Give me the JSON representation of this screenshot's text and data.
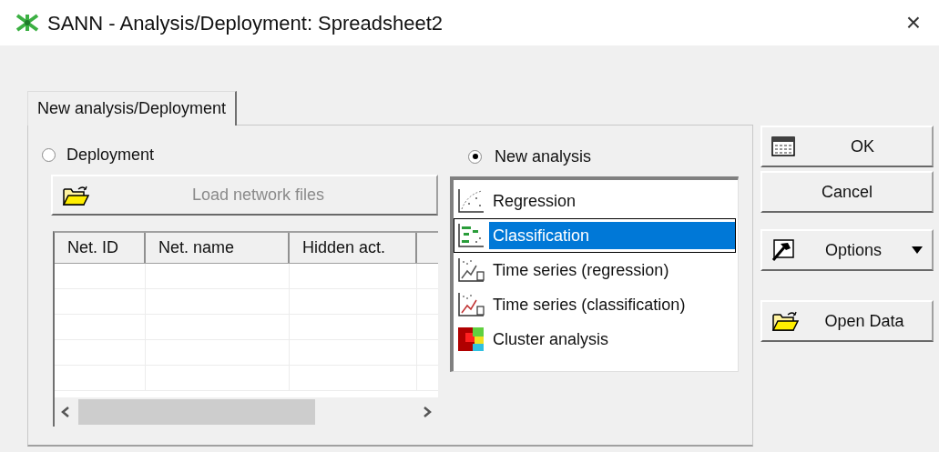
{
  "window": {
    "title": "SANN - Analysis/Deployment: Spreadsheet2",
    "close": "×"
  },
  "tabs": [
    {
      "label": "New analysis/Deployment",
      "selected": true
    }
  ],
  "modes": [
    {
      "label": "Deployment",
      "selected": false
    },
    {
      "label": "New analysis",
      "selected": true
    }
  ],
  "load_button": {
    "label": "Load network files",
    "disabled": true
  },
  "table": {
    "columns": [
      "Net. ID",
      "Net. name",
      "Hidden act."
    ]
  },
  "analysis_types": [
    {
      "label": "Regression",
      "kind": "regression",
      "selected": false
    },
    {
      "label": "Classification",
      "kind": "classification",
      "selected": true
    },
    {
      "label": "Time series (regression)",
      "kind": "ts-regression",
      "selected": false
    },
    {
      "label": "Time series (classification)",
      "kind": "ts-classification",
      "selected": false
    },
    {
      "label": "Cluster analysis",
      "kind": "cluster",
      "selected": false
    }
  ],
  "buttons": [
    {
      "label": "OK",
      "kind": "grid"
    },
    {
      "label": "Cancel",
      "kind": "plain"
    },
    {
      "label": "Options",
      "kind": "hammer",
      "dropdown": true
    },
    {
      "label": "Open Data",
      "kind": "folder"
    }
  ]
}
